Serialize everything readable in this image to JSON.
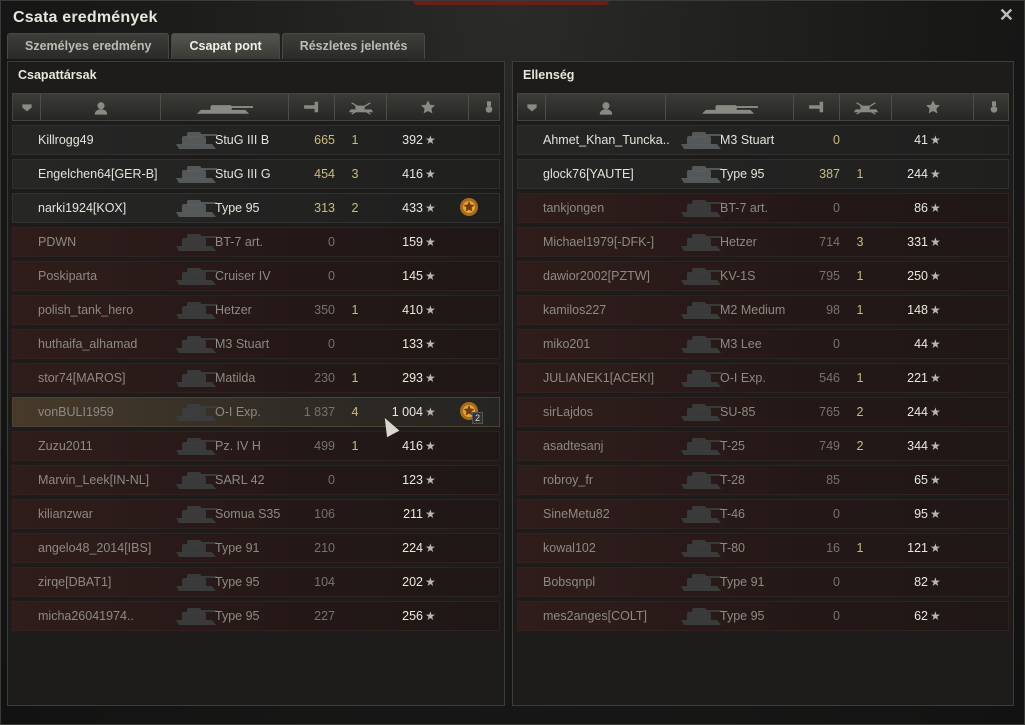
{
  "window": {
    "title": "Csata eredmények",
    "close_label": "✕"
  },
  "tabs": [
    {
      "label": "Személyes eredmény",
      "active": false
    },
    {
      "label": "Csapat pont",
      "active": true
    },
    {
      "label": "Részletes jelentés",
      "active": false
    }
  ],
  "allies": {
    "title": "Csapattársak",
    "rows": [
      {
        "name": "Killrogg49",
        "tank": "StuG III B",
        "damage": "665",
        "kills": "1",
        "xp": "392",
        "dead": false,
        "medal": false
      },
      {
        "name": "Engelchen64[GER-B]",
        "tank": "StuG III G",
        "damage": "454",
        "kills": "3",
        "xp": "416",
        "dead": false,
        "medal": false
      },
      {
        "name": "narki1924[KOX]",
        "tank": "Type 95",
        "damage": "313",
        "kills": "2",
        "xp": "433",
        "dead": false,
        "medal": true
      },
      {
        "name": "PDWN",
        "tank": "BT-7 art.",
        "damage": "0",
        "kills": "",
        "xp": "159",
        "dead": true,
        "medal": false
      },
      {
        "name": "Poskiparta",
        "tank": "Cruiser IV",
        "damage": "0",
        "kills": "",
        "xp": "145",
        "dead": true,
        "medal": false
      },
      {
        "name": "polish_tank_hero",
        "tank": "Hetzer",
        "damage": "350",
        "kills": "1",
        "xp": "410",
        "dead": true,
        "medal": false
      },
      {
        "name": "huthaifa_alhamad",
        "tank": "M3 Stuart",
        "damage": "0",
        "kills": "",
        "xp": "133",
        "dead": true,
        "medal": false
      },
      {
        "name": "stor74[MAROS]",
        "tank": "Matilda",
        "damage": "230",
        "kills": "1",
        "xp": "293",
        "dead": true,
        "medal": false
      },
      {
        "name": "vonBULI1959",
        "tank": "O-I Exp.",
        "damage": "1 837",
        "kills": "4",
        "xp": "1 004",
        "dead": true,
        "medal": true,
        "medal_count": "2",
        "me": true
      },
      {
        "name": "Zuzu2011",
        "tank": "Pz. IV H",
        "damage": "499",
        "kills": "1",
        "xp": "416",
        "dead": true,
        "medal": false
      },
      {
        "name": "Marvin_Leek[IN-NL]",
        "tank": "SARL 42",
        "damage": "0",
        "kills": "",
        "xp": "123",
        "dead": true,
        "medal": false
      },
      {
        "name": "kilianzwar",
        "tank": "Somua S35",
        "damage": "106",
        "kills": "",
        "xp": "211",
        "dead": true,
        "medal": false
      },
      {
        "name": "angelo48_2014[IBS]",
        "tank": "Type 91",
        "damage": "210",
        "kills": "",
        "xp": "224",
        "dead": true,
        "medal": false
      },
      {
        "name": "zirqe[DBAT1]",
        "tank": "Type 95",
        "damage": "104",
        "kills": "",
        "xp": "202",
        "dead": true,
        "medal": false
      },
      {
        "name": "micha26041974..",
        "tank": "Type 95",
        "damage": "227",
        "kills": "",
        "xp": "256",
        "dead": true,
        "medal": false
      }
    ]
  },
  "enemies": {
    "title": "Ellenség",
    "rows": [
      {
        "name": "Ahmet_Khan_Tuncka..",
        "tank": "M3 Stuart",
        "damage": "0",
        "kills": "",
        "xp": "41",
        "dead": false
      },
      {
        "name": "glock76[YAUTE]",
        "tank": "Type 95",
        "damage": "387",
        "kills": "1",
        "xp": "244",
        "dead": false
      },
      {
        "name": "tankjongen",
        "tank": "BT-7 art.",
        "damage": "0",
        "kills": "",
        "xp": "86",
        "dead": true
      },
      {
        "name": "Michael1979[-DFK-]",
        "tank": "Hetzer",
        "damage": "714",
        "kills": "3",
        "xp": "331",
        "dead": true
      },
      {
        "name": "dawior2002[PZTW]",
        "tank": "KV-1S",
        "damage": "795",
        "kills": "1",
        "xp": "250",
        "dead": true
      },
      {
        "name": "kamilos227",
        "tank": "M2 Medium",
        "damage": "98",
        "kills": "1",
        "xp": "148",
        "dead": true
      },
      {
        "name": "miko201",
        "tank": "M3 Lee",
        "damage": "0",
        "kills": "",
        "xp": "44",
        "dead": true
      },
      {
        "name": "JULIANEK1[ACEKI]",
        "tank": "O-I Exp.",
        "damage": "546",
        "kills": "1",
        "xp": "221",
        "dead": true
      },
      {
        "name": "sirLajdos",
        "tank": "SU-85",
        "damage": "765",
        "kills": "2",
        "xp": "244",
        "dead": true
      },
      {
        "name": "asadtesanj",
        "tank": "T-25",
        "damage": "749",
        "kills": "2",
        "xp": "344",
        "dead": true
      },
      {
        "name": "robroy_fr",
        "tank": "T-28",
        "damage": "85",
        "kills": "",
        "xp": "65",
        "dead": true
      },
      {
        "name": "SineMetu82",
        "tank": "T-46",
        "damage": "0",
        "kills": "",
        "xp": "95",
        "dead": true
      },
      {
        "name": "kowal102",
        "tank": "T-80",
        "damage": "16",
        "kills": "1",
        "xp": "121",
        "dead": true
      },
      {
        "name": "Bobsqnpl",
        "tank": "Type 91",
        "damage": "0",
        "kills": "",
        "xp": "82",
        "dead": true
      },
      {
        "name": "mes2anges[COLT]",
        "tank": "Type 95",
        "damage": "0",
        "kills": "",
        "xp": "62",
        "dead": true
      }
    ]
  },
  "icons": {
    "header": [
      "platoon-icon",
      "player-icon",
      "tank-icon",
      "damage-icon",
      "kills-icon",
      "xp-star-icon",
      "medal-icon"
    ],
    "star": "★"
  },
  "colors": {
    "accent_damage": "#cdbb7d",
    "dead_row": "#2f1d1b",
    "highlight_row": "#473a2a"
  }
}
